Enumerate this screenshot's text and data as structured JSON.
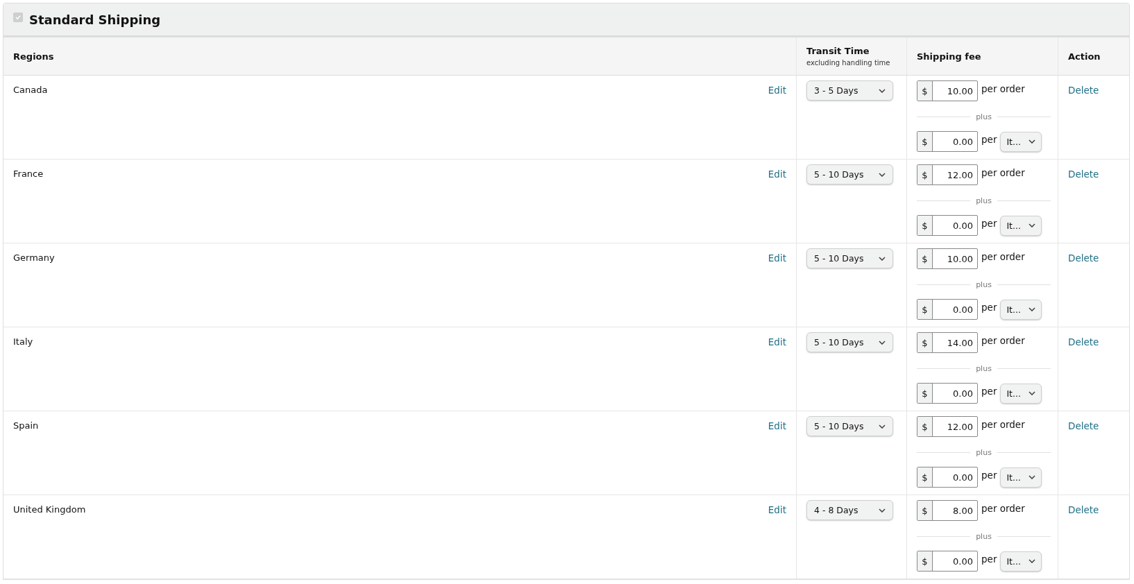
{
  "section": {
    "title": "Standard Shipping",
    "checkbox": {
      "checked": true,
      "disabled": true
    }
  },
  "columns": {
    "regions": "Regions",
    "transit": "Transit Time",
    "transit_note": "excluding handling time",
    "fee": "Shipping fee",
    "action": "Action"
  },
  "rows": [
    {
      "region": "Canada",
      "edit": "Edit",
      "transit": "3 - 5 Days",
      "currency": "$",
      "order_fee": "10.00",
      "per_order": "per order",
      "plus": "plus",
      "currency_2": "$",
      "unit_fee": "0.00",
      "per": "per",
      "unit": "It...",
      "delete": "Delete"
    },
    {
      "region": "France",
      "edit": "Edit",
      "transit": "5 - 10 Days",
      "currency": "$",
      "order_fee": "12.00",
      "per_order": "per order",
      "plus": "plus",
      "currency_2": "$",
      "unit_fee": "0.00",
      "per": "per",
      "unit": "It...",
      "delete": "Delete"
    },
    {
      "region": "Germany",
      "edit": "Edit",
      "transit": "5 - 10 Days",
      "currency": "$",
      "order_fee": "10.00",
      "per_order": "per order",
      "plus": "plus",
      "currency_2": "$",
      "unit_fee": "0.00",
      "per": "per",
      "unit": "It...",
      "delete": "Delete"
    },
    {
      "region": "Italy",
      "edit": "Edit",
      "transit": "5 - 10 Days",
      "currency": "$",
      "order_fee": "14.00",
      "per_order": "per order",
      "plus": "plus",
      "currency_2": "$",
      "unit_fee": "0.00",
      "per": "per",
      "unit": "It...",
      "delete": "Delete"
    },
    {
      "region": "Spain",
      "edit": "Edit",
      "transit": "5 - 10 Days",
      "currency": "$",
      "order_fee": "12.00",
      "per_order": "per order",
      "plus": "plus",
      "currency_2": "$",
      "unit_fee": "0.00",
      "per": "per",
      "unit": "It...",
      "delete": "Delete"
    },
    {
      "region": "United Kingdom",
      "edit": "Edit",
      "transit": "4 - 8 Days",
      "currency": "$",
      "order_fee": "8.00",
      "per_order": "per order",
      "plus": "plus",
      "currency_2": "$",
      "unit_fee": "0.00",
      "per": "per",
      "unit": "It...",
      "delete": "Delete"
    }
  ]
}
